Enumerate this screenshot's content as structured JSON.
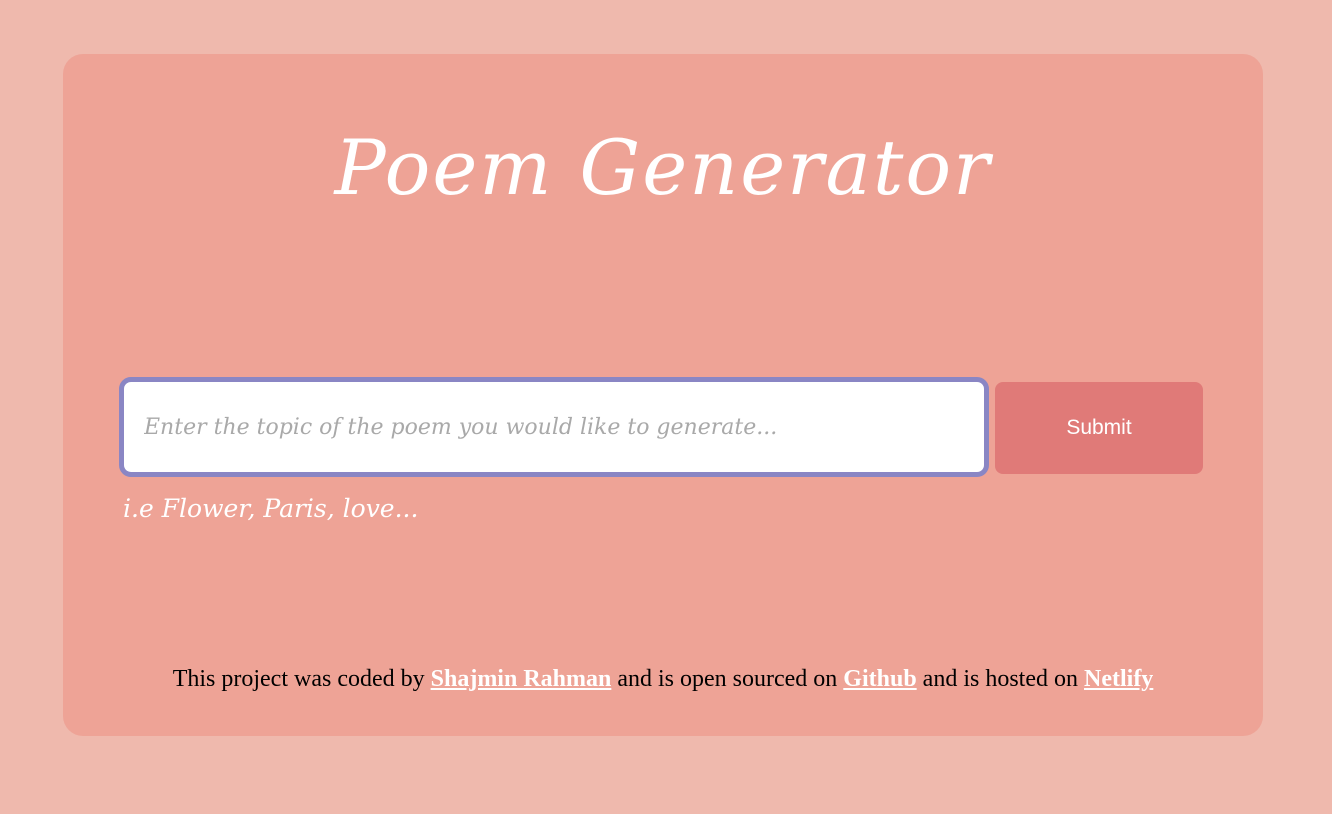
{
  "title": "Poem Generator",
  "search": {
    "placeholder": "Enter the topic of the poem you would like to generate...",
    "value": ""
  },
  "submit_label": "Submit",
  "hint": "i.e Flower, Paris, love...",
  "footer": {
    "text1": "This project was coded by ",
    "author": "Shajmin Rahman",
    "text2": " and is open sourced on ",
    "github": "Github",
    "text3": " and is hosted on ",
    "netlify": "Netlify"
  },
  "colors": {
    "page_bg": "#efb9ad",
    "card_bg": "#eea396",
    "input_border": "#8a86c4",
    "button_bg": "#e07a78"
  }
}
